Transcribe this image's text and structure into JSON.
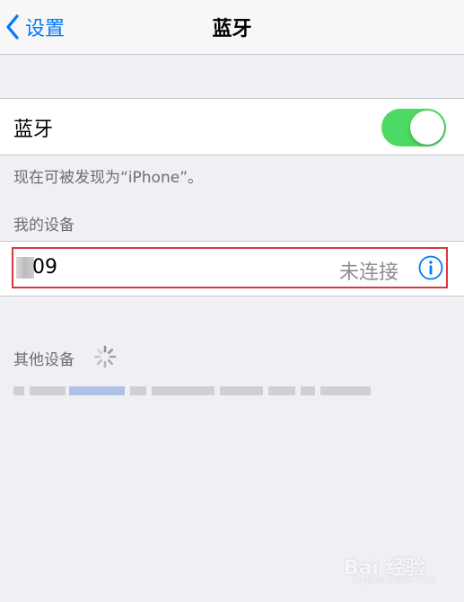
{
  "navbar": {
    "back_label": "设置",
    "title": "蓝牙"
  },
  "bluetooth": {
    "label": "蓝牙",
    "enabled": true,
    "discoverable_text": "现在可被发现为“iPhone”。"
  },
  "my_devices": {
    "header": "我的设备",
    "items": [
      {
        "name": "09",
        "status": "未连接",
        "info_icon": "info-icon"
      }
    ]
  },
  "other_devices": {
    "header": "其他设备",
    "loading_icon": "spinner-icon"
  },
  "watermark": {
    "text": "Bai 经验",
    "sub": "jingyan.baidu.com"
  },
  "colors": {
    "accent": "#007aff",
    "toggle_on": "#4cd964",
    "highlight": "#d9363e",
    "background": "#efeff4"
  }
}
